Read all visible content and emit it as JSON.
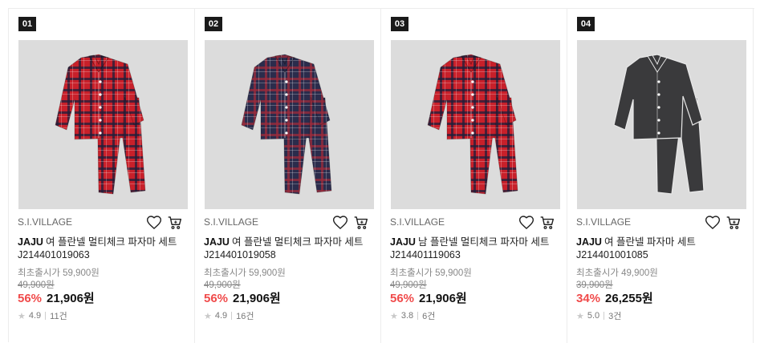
{
  "products": [
    {
      "rank": "01",
      "seller": "S.I.VILLAGE",
      "brand": "JAJU",
      "name": "여 플란넬 멀티체크 파자마 세트 J214401019063",
      "original_label": "최초출시가 59,900원",
      "list_price": "49,900원",
      "discount": "56%",
      "price": "21,906원",
      "rating": "4.9",
      "reviews": "11건",
      "image": {
        "style": "plaid",
        "color": "#c8202a",
        "line": "#1e1e3a"
      }
    },
    {
      "rank": "02",
      "seller": "S.I.VILLAGE",
      "brand": "JAJU",
      "name": "여 플란넬 멀티체크 파자마 세트 J214401019058",
      "original_label": "최초출시가 59,900원",
      "list_price": "49,900원",
      "discount": "56%",
      "price": "21,906원",
      "rating": "4.9",
      "reviews": "16건",
      "image": {
        "style": "plaid",
        "color": "#2b2c4c",
        "line": "#9c2a3a"
      }
    },
    {
      "rank": "03",
      "seller": "S.I.VILLAGE",
      "brand": "JAJU",
      "name": "남 플란넬 멀티체크 파자마 세트 J214401119063",
      "original_label": "최초출시가 59,900원",
      "list_price": "49,900원",
      "discount": "56%",
      "price": "21,906원",
      "rating": "3.8",
      "reviews": "6건",
      "image": {
        "style": "plaid",
        "color": "#c8202a",
        "line": "#1e1e3a"
      }
    },
    {
      "rank": "04",
      "seller": "S.I.VILLAGE",
      "brand": "JAJU",
      "name": "여 플란넬 파자마 세트 J214401001085",
      "original_label": "최초출시가 49,900원",
      "list_price": "39,900원",
      "discount": "34%",
      "price": "26,255원",
      "rating": "5.0",
      "reviews": "3건",
      "image": {
        "style": "piped",
        "color": "#3a3a3c",
        "line": "#e8e8e8"
      }
    }
  ],
  "icons": {
    "wishlist": "heart-icon",
    "cart": "cart-icon",
    "rating": "star-icon"
  },
  "colors": {
    "discount": "#f04a4a",
    "rank_badge": "#1a1a1a"
  }
}
